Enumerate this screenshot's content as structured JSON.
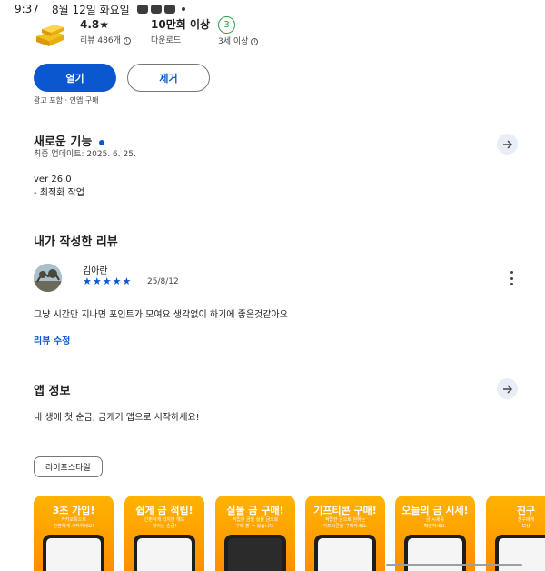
{
  "status_bar": {
    "time": "9:37",
    "date": "8월 12일 화요일"
  },
  "stats": {
    "rating": "4.8★",
    "reviews": "리뷰 486개",
    "downloads": "10만회 이상",
    "downloads_label": "다운로드",
    "age_badge": "3",
    "age_label": "3세 이상"
  },
  "actions": {
    "open_label": "열기",
    "remove_label": "제거",
    "ads_note": "광고 포함 · 인앱 구매"
  },
  "whats_new": {
    "title": "새로운 기능",
    "updated": "최종 업데이트: 2025. 6. 25.",
    "version": "ver 26.0",
    "note": "- 최적화 작업"
  },
  "my_review": {
    "title": "내가 작성한 리뷰",
    "reviewer": "김아란",
    "stars": "★★★★★",
    "rating_value": 5,
    "date": "25/8/12",
    "text": "그냥 시간만 지나면 포인트가 모여요 생각없이 하기에 좋은것같아요",
    "edit_label": "리뷰 수정"
  },
  "app_info": {
    "title": "앱 정보",
    "description": "내 생애 첫 순금, 금캐기 앱으로 시작하세요!",
    "category_chip": "라이프스타일"
  },
  "screenshots": [
    {
      "title": "3초 가입!",
      "sub": "카카오톡으로\n간편하게 시작하세요!"
    },
    {
      "title": "쉽게 금 적립!",
      "sub": "간편하게 터치만 해도\n쌓이는 순금!"
    },
    {
      "title": "실물 금 구매!",
      "sub": "적립한 금을 실물 금으로\n구매 할 수 있습니다."
    },
    {
      "title": "기프티콘 구매!",
      "sub": "적립한 금으로 원하는\n기프티콘을 구매하세요."
    },
    {
      "title": "오늘의 금 시세!",
      "sub": "금 시세를\n확인하세요."
    },
    {
      "title": "친구",
      "sub": "친구에게\n보상"
    }
  ],
  "colors": {
    "accent": "#0b57d0",
    "age_badge": "#2e9d4a",
    "screenshot_bg": "#ffa000"
  },
  "icons": {
    "arrow": "arrow-right-icon",
    "more": "more-vert-icon",
    "info": "info-icon"
  }
}
